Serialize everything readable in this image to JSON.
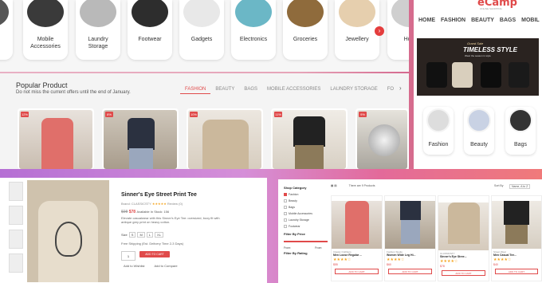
{
  "categories": [
    {
      "label": "Mobile\nAccessories",
      "icon": "phone-accessories-icon"
    },
    {
      "label": "Laundry\nStorage",
      "icon": "laundry-basket-icon"
    },
    {
      "label": "Footwear",
      "icon": "shoe-icon"
    },
    {
      "label": "Gadgets",
      "icon": "gadgets-icon"
    },
    {
      "label": "Electronics",
      "icon": "electronics-icon"
    },
    {
      "label": "Groceries",
      "icon": "groceries-icon"
    },
    {
      "label": "Jewellery",
      "icon": "jewellery-icon"
    },
    {
      "label": "Hom",
      "icon": "home-icon"
    }
  ],
  "popular": {
    "title": "Popular Product",
    "subtitle": "Do not miss the current offers until the end of January.",
    "tabs": [
      "FASHION",
      "BEAUTY",
      "BAGS",
      "MOBILE ACCESSORIES",
      "LAUNDRY STORAGE",
      "FO"
    ],
    "badges": [
      "12%",
      "8%",
      "10%",
      "11%",
      "9%"
    ]
  },
  "site": {
    "logo": "eCamp",
    "logo_sub": "ONLINE SHOPPING",
    "nav": [
      "HOME",
      "FASHION",
      "BEAUTY",
      "BAGS",
      "MOBIL"
    ],
    "banner_tag": "Grand Sale",
    "banner_title": "TIMELESS STYLE",
    "banner_sub": "Wear the season in style",
    "circle_cats": [
      "Fashion",
      "Beauty",
      "Bags"
    ]
  },
  "product": {
    "title": "Sinner's Eye Street Print Tee",
    "brand_line": "Brand: CLASSICSTY",
    "reviews": "Review (0)",
    "stars": "★★★★★",
    "old_price": "$98",
    "price": "$78",
    "stock": "Available In Stock: 156",
    "description": "Elevate casualwear with this Sinner's Eye Tee: oversized, boxy fit with antique grey print on heavy cotton.",
    "size_label": "Size",
    "sizes": [
      "S",
      "M",
      "L",
      "XL"
    ],
    "shipping": "Free Shipping (Est. Delivery Time 2-3 Days)",
    "qty": "1",
    "add_to_cart": "ADD TO CART",
    "wishlist": "Add to Wishlist",
    "compare": "Add to Compare"
  },
  "listing": {
    "filter_title": "Shop Category",
    "filters": [
      {
        "label": "Fashion",
        "on": true
      },
      {
        "label": "Beauty",
        "on": false
      },
      {
        "label": "Bags",
        "on": false
      },
      {
        "label": "Mobile Accessories",
        "on": false
      },
      {
        "label": "Laundry Storage",
        "on": false
      },
      {
        "label": "Footwear",
        "on": false
      },
      {
        "label": "Gadgets",
        "on": false
      }
    ],
    "price_title": "Filter By Price",
    "price_from": "From:",
    "price_to": "From:",
    "rating_title": "Filter By Rating",
    "count": "There are 9 Products",
    "sort_label": "Sort By",
    "sort_value": "Name, A to Z",
    "items": [
      {
        "brand": "Classic Outfitters",
        "name": "Men Loose Regular ...",
        "price": "$55",
        "btn": "ADD TO CART"
      },
      {
        "brand": "Fashion Studio",
        "name": "Women Wide Leg Hi...",
        "price": "$60",
        "btn": "ADD TO CART"
      },
      {
        "brand": "CLASSICSTY",
        "name": "Sinner's Eye Stree...",
        "price": "$78",
        "btn": "ADD TO CART"
      },
      {
        "brand": "Street Wear",
        "name": "Men Casual Tee...",
        "price": "$40",
        "btn": "ADD TO CART"
      }
    ]
  }
}
